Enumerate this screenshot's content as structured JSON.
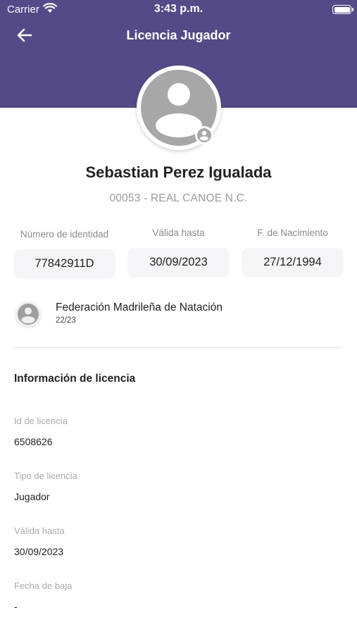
{
  "status_bar": {
    "carrier": "Carrier",
    "time": "3:43 p.m."
  },
  "header": {
    "title": "Licencia Jugador",
    "back_icon": "arrow-left-icon",
    "color": "#534a87"
  },
  "player": {
    "name": "Sebastian Perez Igualada",
    "club": "00053 - REAL CANOE N.C."
  },
  "fields": [
    {
      "label": "Número de identidad",
      "value": "77842911D"
    },
    {
      "label": "Válida hasta",
      "value": "30/09/2023"
    },
    {
      "label": "F. de Nacimiento",
      "value": "27/12/1994"
    }
  ],
  "federation": {
    "name": "Federación Madrileña de Natación",
    "season": "22/23"
  },
  "license_info": {
    "title": "Información de licencia",
    "items": [
      {
        "label": "Id de licencia",
        "value": "6508626"
      },
      {
        "label": "Tipo de licencia",
        "value": "Jugador"
      },
      {
        "label": "Válida hasta",
        "value": "30/09/2023"
      },
      {
        "label": "Fecha de baja",
        "value": "-"
      }
    ]
  }
}
